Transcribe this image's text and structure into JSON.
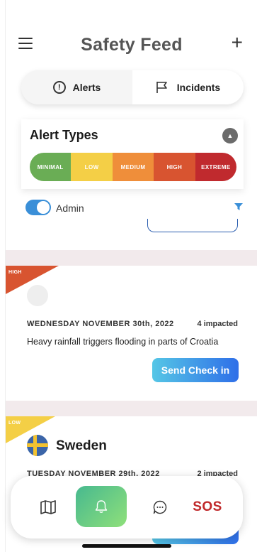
{
  "header": {
    "title": "Safety Feed"
  },
  "tabs": [
    {
      "label": "Alerts",
      "icon": "alert-circle-icon",
      "active": true
    },
    {
      "label": "Incidents",
      "icon": "flag-icon",
      "active": false
    }
  ],
  "alert_types": {
    "title": "Alert Types",
    "levels": [
      {
        "label": "MINIMAL",
        "color": "#6aad55"
      },
      {
        "label": "LOW",
        "color": "#f4cf46"
      },
      {
        "label": "MEDIUM",
        "color": "#ef8e3a"
      },
      {
        "label": "HIGH",
        "color": "#d85430"
      },
      {
        "label": "EXTREME",
        "color": "#c02a2e"
      }
    ]
  },
  "filter": {
    "toggle_label": "Admin",
    "toggle_on": true
  },
  "feed": [
    {
      "severity": "HIGH",
      "severity_color": "#d85430",
      "country": "",
      "date": "WEDNESDAY NOVEMBER 30th, 2022",
      "impacted": "4 impacted",
      "headline": "Heavy rainfall triggers flooding in parts of Croatia",
      "button_label": "Send Check in"
    },
    {
      "severity": "LOW",
      "severity_color": "#f4cf46",
      "country": "Sweden",
      "date": "TUESDAY NOVEMBER 29th, 2022",
      "impacted": "2 impacted"
    }
  ],
  "bottom_nav": {
    "items": [
      {
        "name": "map",
        "icon": "map-icon"
      },
      {
        "name": "alerts",
        "icon": "bell-icon",
        "active": true
      },
      {
        "name": "chat",
        "icon": "chat-bubble-icon"
      },
      {
        "name": "sos",
        "label": "SOS"
      }
    ]
  }
}
